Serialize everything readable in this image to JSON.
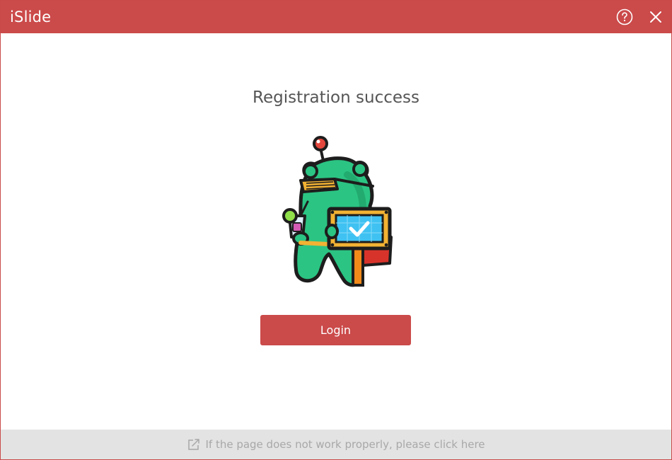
{
  "window": {
    "title": "iSlide",
    "help_icon": "help-circle-icon",
    "close_icon": "close-icon"
  },
  "main": {
    "headline": "Registration success",
    "illustration": "mascot-success-illustration",
    "login_label": "Login"
  },
  "footer": {
    "icon": "external-link-icon",
    "text": "If the page does not work properly, please click here"
  },
  "colors": {
    "accent": "#cb4a4a",
    "footer_bg": "#e3e3e3",
    "footer_text": "#a8a8a8",
    "headline_text": "#555555"
  }
}
